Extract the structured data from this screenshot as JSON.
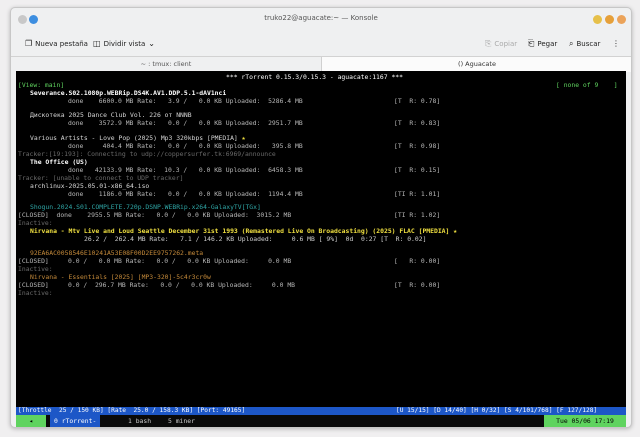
{
  "window": {
    "title": "truko22@aguacate:~ — Konsole"
  },
  "toolbar": {
    "new_tab": "Nueva pestaña",
    "split_view": "Dividir vista",
    "copy": "Copiar",
    "paste": "Pegar",
    "search": "Buscar"
  },
  "tabs": [
    {
      "label": "~ : tmux: client"
    },
    {
      "label": "() Aguacate"
    }
  ],
  "rtorrent": {
    "header": "*** rTorrent 0.15.3/0.15.3 - aguacate:1167 ***",
    "view": "[View: main]",
    "pager": "[ none of 9    ]",
    "torrents": [
      {
        "name": "Severance.S02.1080p.WEBRip.DS4K.AV1.DDP.5.1-dAV1nci",
        "info": "done    6600.0 MB Rate:   3.9 /   0.0 KB Uploaded:  5286.4 MB",
        "right": "[T  R: 0.78]"
      },
      {
        "name": "Дискотека 2025 Dance Club Vol. 226 от NNNB",
        "info": "done    3572.9 MB Rate:   0.0 /   0.0 KB Uploaded:  2951.7 MB",
        "right": "[T  R: 0.83]"
      },
      {
        "name": "Various Artists - Love Pop (2025) Mp3 320kbps [PMEDIA]",
        "info": "done     404.4 MB Rate:   0.0 /   0.0 KB Uploaded:   395.8 MB",
        "right": "[T  R: 0.98]",
        "tracker": "Tracker:[19:193]: Connecting to udp://coppersurfer.tk:6969/announce"
      },
      {
        "name": "The Office (US)",
        "info": "done   42133.9 MB Rate:  10.3 /   0.0 KB Uploaded:  6458.3 MB",
        "right": "[T  R: 0.15]",
        "tracker": "Tracker: [unable to connect to UDP tracker]"
      },
      {
        "name": "archlinux-2025.05.01-x86_64.iso",
        "info": "done    1186.0 MB Rate:   0.0 /   0.0 KB Uploaded:  1194.4 MB",
        "right": "[TI R: 1.01]"
      },
      {
        "name": "Shogun.2024.S01.COMPLETE.720p.DSNP.WEBRip.x264-GalaxyTV[TGx]",
        "info": "[CLOSED]  done    2955.5 MB Rate:   0.0 /   0.0 KB Uploaded:  3015.2 MB",
        "right": "[TI R: 1.02]",
        "inactive": "Inactive:"
      },
      {
        "name": "Nirvana - Mtv Live and Loud Seattle December 31st 1993 (Remastered Live On Broadcasting) (2025) FLAC [PMEDIA]",
        "info": "26.2 /  262.4 MB Rate:   7.1 / 146.2 KB Uploaded:     0.6 MB [ 9%]  0d  0:27 [T  R: 0.02]",
        "right": ""
      },
      {
        "name": "92EA6AC0058546E10241A53E08F00D2EE9757262.meta",
        "info": "[CLOSED]     0.0 /   0.0 MB Rate:   0.0 /   0.0 KB Uploaded:     0.0 MB",
        "right": "[   R: 0.00]",
        "inactive": "Inactive:"
      },
      {
        "name": "Nirvana - Essentials [2025] [MP3-320]-5c4r3cr0w",
        "info": "[CLOSED]     0.0 /  296.7 MB Rate:   0.0 /   0.0 KB Uploaded:     0.0 MB",
        "right": "[T  R: 0.00]",
        "inactive": "Inactive:"
      }
    ],
    "status_left": "[Throttle  25 / 150 KB] [Rate  25.0 / 158.3 KB] [Port: 49165]",
    "status_right": "[U 15/15] [D 14/40] [H 0/32] [S 4/101/768] [F 127/128]"
  },
  "tmux": {
    "window0": "0 rTorrent-",
    "window1": "1 bash",
    "window2": "5 miner",
    "clock": "Tue 05/06 17:19"
  },
  "colors": {
    "accent": "#5fd35f",
    "statusbar": "#1d57c7"
  }
}
